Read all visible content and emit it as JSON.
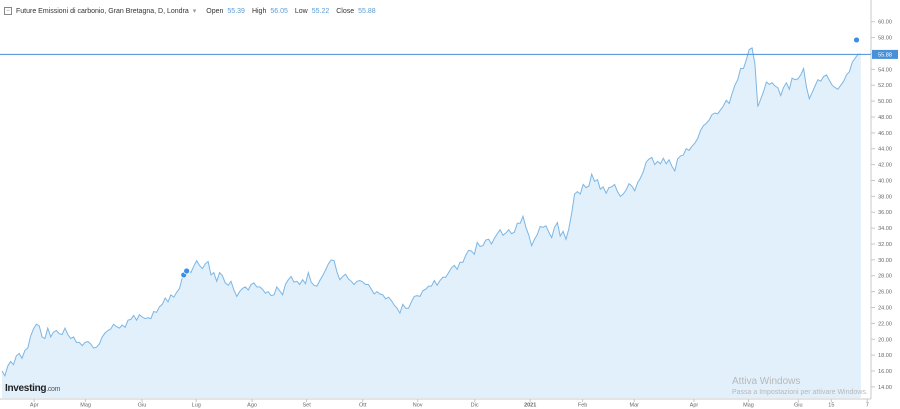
{
  "header": {
    "title": "Future Emissioni di carbonio, Gran Bretagna, D, Londra",
    "open_label": "Open",
    "open_value": "55.39",
    "high_label": "High",
    "high_value": "56.05",
    "low_label": "Low",
    "low_value": "55.22",
    "close_label": "Close",
    "close_value": "55.88"
  },
  "logo": {
    "main": "Investing",
    "suffix": ".com"
  },
  "watermark": {
    "line1": "Attiva Windows",
    "line2": "Passa a Impostazioni per attivare Windows."
  },
  "chart_data": {
    "type": "area",
    "ylim": [
      12.6,
      61.6
    ],
    "y_ticks": [
      "14.00",
      "16.00",
      "18.00",
      "20.00",
      "22.00",
      "24.00",
      "26.00",
      "28.00",
      "30.00",
      "32.00",
      "34.00",
      "36.00",
      "38.00",
      "40.00",
      "42.00",
      "44.00",
      "46.00",
      "48.00",
      "50.00",
      "52.00",
      "54.00",
      "56.00",
      "58.00",
      "60.00"
    ],
    "x_ticks": [
      {
        "t": 22.5,
        "label": "Apr"
      },
      {
        "t": 58.4,
        "label": "Mag"
      },
      {
        "t": 97.8,
        "label": "Giu"
      },
      {
        "t": 135.7,
        "label": "Lug"
      },
      {
        "t": 174.7,
        "label": "Ago"
      },
      {
        "t": 212.8,
        "label": "Set"
      },
      {
        "t": 252.0,
        "label": "Ott"
      },
      {
        "t": 290.4,
        "label": "Nov"
      },
      {
        "t": 330.2,
        "label": "Dic"
      },
      {
        "t": 369.0,
        "label": "2021"
      },
      {
        "t": 405.6,
        "label": "Feb"
      },
      {
        "t": 441.7,
        "label": "Mar"
      },
      {
        "t": 483.4,
        "label": "Apr"
      },
      {
        "t": 521.5,
        "label": "Mag"
      },
      {
        "t": 556.3,
        "label": "Giu"
      },
      {
        "t": 579.4,
        "label": "15"
      },
      {
        "t": 604.5,
        "label": "7"
      }
    ],
    "last_value_label": "55.88",
    "last_value": 55.88,
    "series": [
      {
        "values": [
          [
            0,
            16.0
          ],
          [
            2,
            15.4
          ],
          [
            4,
            16.6
          ],
          [
            6,
            17.2
          ],
          [
            8,
            16.8
          ],
          [
            10,
            17.9
          ],
          [
            12,
            18.2
          ],
          [
            14,
            17.6
          ],
          [
            16,
            18.6
          ],
          [
            18,
            18.9
          ],
          [
            20,
            20.4
          ],
          [
            22,
            21.3
          ],
          [
            24,
            21.9
          ],
          [
            26,
            21.7
          ],
          [
            28,
            20.3
          ],
          [
            30,
            20.1
          ],
          [
            32,
            21.4
          ],
          [
            34,
            20.3
          ],
          [
            36,
            20.9
          ],
          [
            38,
            21.1
          ],
          [
            40,
            20.7
          ],
          [
            42,
            20.6
          ],
          [
            44,
            21.4
          ],
          [
            46,
            20.6
          ],
          [
            48,
            20.1
          ],
          [
            50,
            20.3
          ],
          [
            52,
            19.6
          ],
          [
            54,
            19.6
          ],
          [
            56,
            19.2
          ],
          [
            58,
            19.6
          ],
          [
            60,
            19.7
          ],
          [
            62,
            19.4
          ],
          [
            64,
            18.9
          ],
          [
            66,
            19.0
          ],
          [
            68,
            19.4
          ],
          [
            70,
            20.3
          ],
          [
            72,
            20.8
          ],
          [
            74,
            21.1
          ],
          [
            76,
            21.3
          ],
          [
            78,
            21.9
          ],
          [
            80,
            21.6
          ],
          [
            82,
            21.4
          ],
          [
            84,
            21.8
          ],
          [
            86,
            21.5
          ],
          [
            88,
            22.4
          ],
          [
            90,
            22.5
          ],
          [
            92,
            23.0
          ],
          [
            94,
            22.4
          ],
          [
            96,
            23.1
          ],
          [
            98,
            22.8
          ],
          [
            100,
            22.6
          ],
          [
            102,
            22.7
          ],
          [
            104,
            22.6
          ],
          [
            106,
            23.5
          ],
          [
            108,
            23.4
          ],
          [
            110,
            24.1
          ],
          [
            112,
            24.4
          ],
          [
            114,
            25.2
          ],
          [
            116,
            24.7
          ],
          [
            118,
            25.6
          ],
          [
            120,
            25.3
          ],
          [
            122,
            25.9
          ],
          [
            124,
            26.4
          ],
          [
            126,
            27.8
          ],
          [
            128,
            27.9
          ],
          [
            130,
            28.7
          ],
          [
            132,
            28.4
          ],
          [
            134,
            29.2
          ],
          [
            136,
            29.9
          ],
          [
            138,
            29.3
          ],
          [
            140,
            28.9
          ],
          [
            142,
            29.5
          ],
          [
            144,
            29.8
          ],
          [
            146,
            28.1
          ],
          [
            148,
            28.4
          ],
          [
            150,
            27.3
          ],
          [
            152,
            28.4
          ],
          [
            154,
            28.0
          ],
          [
            156,
            27.1
          ],
          [
            158,
            26.8
          ],
          [
            160,
            27.3
          ],
          [
            162,
            26.2
          ],
          [
            164,
            25.4
          ],
          [
            166,
            26.0
          ],
          [
            168,
            26.4
          ],
          [
            170,
            26.6
          ],
          [
            172,
            26.2
          ],
          [
            174,
            26.9
          ],
          [
            176,
            27.1
          ],
          [
            178,
            26.6
          ],
          [
            180,
            26.6
          ],
          [
            182,
            26.3
          ],
          [
            184,
            25.8
          ],
          [
            186,
            26.0
          ],
          [
            188,
            25.5
          ],
          [
            190,
            25.6
          ],
          [
            192,
            26.6
          ],
          [
            194,
            26.1
          ],
          [
            196,
            25.6
          ],
          [
            198,
            26.9
          ],
          [
            200,
            27.5
          ],
          [
            202,
            27.9
          ],
          [
            204,
            27.2
          ],
          [
            206,
            27.3
          ],
          [
            208,
            26.9
          ],
          [
            210,
            27.5
          ],
          [
            212,
            27.0
          ],
          [
            214,
            28.4
          ],
          [
            216,
            27.2
          ],
          [
            218,
            26.8
          ],
          [
            220,
            26.7
          ],
          [
            222,
            27.4
          ],
          [
            224,
            28.0
          ],
          [
            226,
            28.7
          ],
          [
            228,
            29.5
          ],
          [
            230,
            30.0
          ],
          [
            232,
            29.9
          ],
          [
            234,
            28.5
          ],
          [
            236,
            27.5
          ],
          [
            238,
            27.9
          ],
          [
            240,
            28.2
          ],
          [
            242,
            27.6
          ],
          [
            244,
            27.3
          ],
          [
            246,
            26.9
          ],
          [
            248,
            27.3
          ],
          [
            250,
            27.4
          ],
          [
            252,
            27.2
          ],
          [
            254,
            26.9
          ],
          [
            256,
            26.9
          ],
          [
            258,
            26.3
          ],
          [
            260,
            25.7
          ],
          [
            262,
            26.0
          ],
          [
            264,
            25.7
          ],
          [
            266,
            25.6
          ],
          [
            268,
            25.1
          ],
          [
            270,
            25.3
          ],
          [
            272,
            24.9
          ],
          [
            274,
            24.3
          ],
          [
            276,
            23.9
          ],
          [
            278,
            23.3
          ],
          [
            280,
            24.4
          ],
          [
            282,
            23.9
          ],
          [
            284,
            23.9
          ],
          [
            286,
            24.7
          ],
          [
            288,
            25.4
          ],
          [
            290,
            25.5
          ],
          [
            292,
            25.4
          ],
          [
            294,
            26.1
          ],
          [
            296,
            26.3
          ],
          [
            298,
            26.7
          ],
          [
            300,
            26.7
          ],
          [
            302,
            27.4
          ],
          [
            304,
            26.8
          ],
          [
            306,
            27.4
          ],
          [
            308,
            27.8
          ],
          [
            310,
            27.8
          ],
          [
            312,
            28.4
          ],
          [
            314,
            29.0
          ],
          [
            316,
            29.3
          ],
          [
            318,
            28.8
          ],
          [
            320,
            29.7
          ],
          [
            322,
            29.7
          ],
          [
            324,
            30.6
          ],
          [
            326,
            31.2
          ],
          [
            328,
            31.1
          ],
          [
            330,
            30.7
          ],
          [
            332,
            32.2
          ],
          [
            334,
            31.7
          ],
          [
            336,
            31.8
          ],
          [
            338,
            32.5
          ],
          [
            340,
            32.6
          ],
          [
            342,
            32.0
          ],
          [
            344,
            32.7
          ],
          [
            346,
            33.3
          ],
          [
            348,
            33.8
          ],
          [
            350,
            33.1
          ],
          [
            352,
            33.4
          ],
          [
            354,
            33.8
          ],
          [
            356,
            33.3
          ],
          [
            358,
            33.5
          ],
          [
            360,
            34.6
          ],
          [
            362,
            34.6
          ],
          [
            364,
            35.5
          ],
          [
            366,
            34.1
          ],
          [
            368,
            33.1
          ],
          [
            370,
            31.8
          ],
          [
            372,
            32.6
          ],
          [
            374,
            33.2
          ],
          [
            376,
            34.2
          ],
          [
            378,
            34.1
          ],
          [
            380,
            34.3
          ],
          [
            382,
            33.5
          ],
          [
            384,
            32.8
          ],
          [
            386,
            34.1
          ],
          [
            388,
            34.7
          ],
          [
            390,
            33.0
          ],
          [
            392,
            33.6
          ],
          [
            394,
            32.6
          ],
          [
            396,
            33.9
          ],
          [
            398,
            35.9
          ],
          [
            400,
            38.3
          ],
          [
            402,
            38.6
          ],
          [
            404,
            38.3
          ],
          [
            406,
            39.5
          ],
          [
            408,
            39.1
          ],
          [
            410,
            39.3
          ],
          [
            412,
            40.8
          ],
          [
            414,
            39.9
          ],
          [
            416,
            40.1
          ],
          [
            418,
            38.9
          ],
          [
            420,
            39.2
          ],
          [
            422,
            38.4
          ],
          [
            424,
            39.1
          ],
          [
            426,
            39.2
          ],
          [
            428,
            39.5
          ],
          [
            430,
            38.6
          ],
          [
            432,
            38.0
          ],
          [
            434,
            38.3
          ],
          [
            436,
            38.8
          ],
          [
            438,
            39.6
          ],
          [
            440,
            39.3
          ],
          [
            442,
            38.7
          ],
          [
            444,
            39.7
          ],
          [
            446,
            40.3
          ],
          [
            448,
            41.1
          ],
          [
            450,
            42.3
          ],
          [
            452,
            42.7
          ],
          [
            454,
            42.9
          ],
          [
            456,
            42.0
          ],
          [
            458,
            42.4
          ],
          [
            460,
            42.1
          ],
          [
            462,
            42.8
          ],
          [
            464,
            42.1
          ],
          [
            466,
            42.6
          ],
          [
            468,
            41.8
          ],
          [
            470,
            41.2
          ],
          [
            472,
            42.7
          ],
          [
            474,
            43.1
          ],
          [
            476,
            43.2
          ],
          [
            478,
            44.0
          ],
          [
            480,
            43.8
          ],
          [
            482,
            44.3
          ],
          [
            484,
            44.7
          ],
          [
            486,
            45.3
          ],
          [
            488,
            46.3
          ],
          [
            490,
            46.9
          ],
          [
            492,
            47.2
          ],
          [
            494,
            47.6
          ],
          [
            496,
            48.3
          ],
          [
            498,
            48.5
          ],
          [
            500,
            48.4
          ],
          [
            502,
            48.9
          ],
          [
            504,
            49.4
          ],
          [
            506,
            50.1
          ],
          [
            508,
            49.7
          ],
          [
            510,
            50.9
          ],
          [
            512,
            52.0
          ],
          [
            514,
            52.7
          ],
          [
            516,
            54.1
          ],
          [
            518,
            54.1
          ],
          [
            520,
            55.2
          ],
          [
            522,
            56.5
          ],
          [
            524,
            56.7
          ],
          [
            526,
            54.7
          ],
          [
            528,
            49.3
          ],
          [
            530,
            50.2
          ],
          [
            532,
            51.2
          ],
          [
            534,
            52.4
          ],
          [
            536,
            52.1
          ],
          [
            538,
            52.3
          ],
          [
            540,
            51.9
          ],
          [
            542,
            51.7
          ],
          [
            544,
            50.7
          ],
          [
            546,
            51.7
          ],
          [
            548,
            52.3
          ],
          [
            550,
            51.5
          ],
          [
            552,
            52.9
          ],
          [
            554,
            52.7
          ],
          [
            556,
            52.8
          ],
          [
            558,
            53.3
          ],
          [
            560,
            54.1
          ],
          [
            562,
            51.8
          ],
          [
            564,
            50.3
          ],
          [
            566,
            51.1
          ],
          [
            568,
            51.9
          ],
          [
            570,
            52.7
          ],
          [
            572,
            52.5
          ],
          [
            574,
            53.1
          ],
          [
            576,
            53.3
          ],
          [
            578,
            52.6
          ],
          [
            580,
            52.0
          ],
          [
            582,
            51.7
          ],
          [
            584,
            51.5
          ],
          [
            586,
            52.0
          ],
          [
            588,
            52.5
          ],
          [
            590,
            53.3
          ],
          [
            592,
            53.7
          ],
          [
            594,
            54.9
          ],
          [
            596,
            55.4
          ],
          [
            598,
            55.9
          ],
          [
            600,
            55.9
          ]
        ]
      }
    ]
  }
}
